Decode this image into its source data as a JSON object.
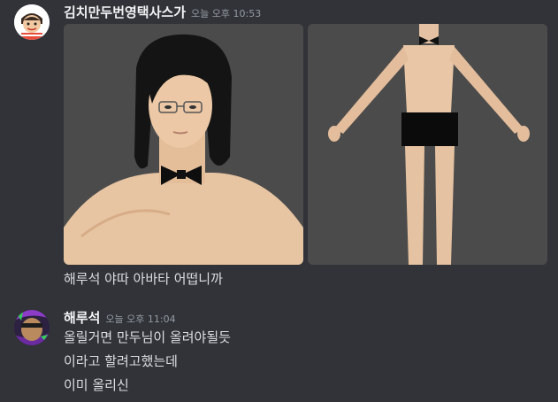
{
  "messages": [
    {
      "author": "김치만두번영택사스가",
      "timestamp": "오늘 오후 10:53",
      "avatar_icon": "cartoon-face-avatar",
      "attachments": [
        {
          "kind": "image",
          "icon": "avatar-portrait-image"
        },
        {
          "kind": "image",
          "icon": "avatar-full-body-image"
        }
      ],
      "lines": [
        "해루석 야따 아바타 어떱니까"
      ]
    },
    {
      "author": "해루석",
      "timestamp": "오늘 오후 11:04",
      "avatar_icon": "photo-avatar",
      "lines": [
        "올릴거면 만두님이 올려야될듯",
        "이라고 할려고했는데",
        "이미 올리신"
      ]
    }
  ],
  "colors": {
    "background": "#313338",
    "author_text": "#f2f3f5",
    "body_text": "#dbdee1",
    "timestamp": "#949ba4"
  }
}
